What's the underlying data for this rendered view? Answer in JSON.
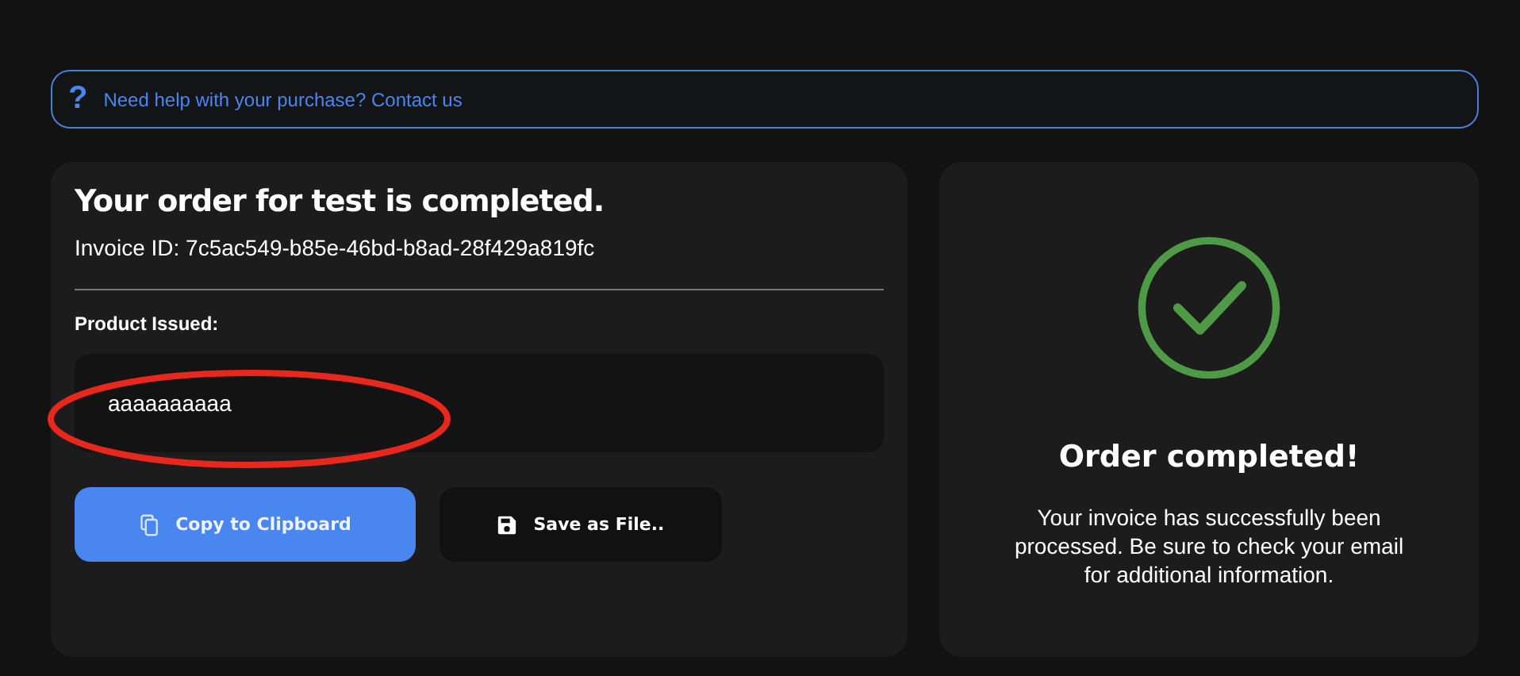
{
  "help_banner": {
    "icon": "?",
    "text": "Need help with your purchase? Contact us"
  },
  "order": {
    "title": "Your order for test is completed.",
    "invoice": "Invoice ID: 7c5ac549-b85e-46bd-b8ad-28f429a819fc",
    "product_label": "Product Issued:",
    "product_value": "aaaaaaaaaa",
    "annotated": true,
    "buttons": [
      {
        "kind": "copy",
        "label": "Copy to Clipboard"
      },
      {
        "kind": "save",
        "label": "Save as File.."
      }
    ]
  },
  "status": {
    "title": "Order completed!",
    "message": "Your invoice has successfully been processed. Be sure to check your email for additional information."
  }
}
